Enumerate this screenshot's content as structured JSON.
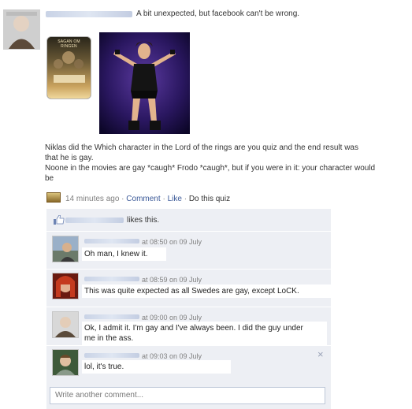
{
  "post": {
    "status_text": "A bit unexpected, but facebook can't be wrong.",
    "description_line1": "Niklas did the Which character in the Lord of the rings are you quiz and the end result was",
    "description_line2": "that he is gay.",
    "description_line3": "Noone in the movies are gay *caugh* Frodo *caugh*, but if you were in it: your character would",
    "description_line4": "be",
    "timestamp": "14 minutes ago",
    "actions": {
      "sep1": "·",
      "comment": "Comment",
      "sep2": "·",
      "like": "Like",
      "sep3": "·",
      "quiz": "Do this quiz"
    }
  },
  "thumbnail": {
    "poster_title": "SAGAN OM RINGEN"
  },
  "likes": {
    "text": "likes this."
  },
  "comments": [
    {
      "time": "at 08:50 on 09 July",
      "text": "Oh man, I knew it."
    },
    {
      "time": "at 08:59 on 09 July",
      "text": "This was quite expected as all Swedes are gay, except LoCK."
    },
    {
      "time": "at 09:00 on 09 July",
      "text_line1": "Ok, I admit it. I'm gay and I've always been. I did the guy under",
      "text_line2": "me in the ass."
    },
    {
      "time": "at 09:03 on 09 July",
      "text": "lol, it's true.",
      "delete_glyph": "×"
    }
  ],
  "new_comment": {
    "placeholder": "Write another comment..."
  },
  "colors": {
    "link": "#3b5998",
    "comment_bg": "#edeff4",
    "meta_grey": "#808080"
  },
  "icons": [
    "avatar",
    "quiz-icon",
    "thumbs-up-icon",
    "delete-icon"
  ]
}
